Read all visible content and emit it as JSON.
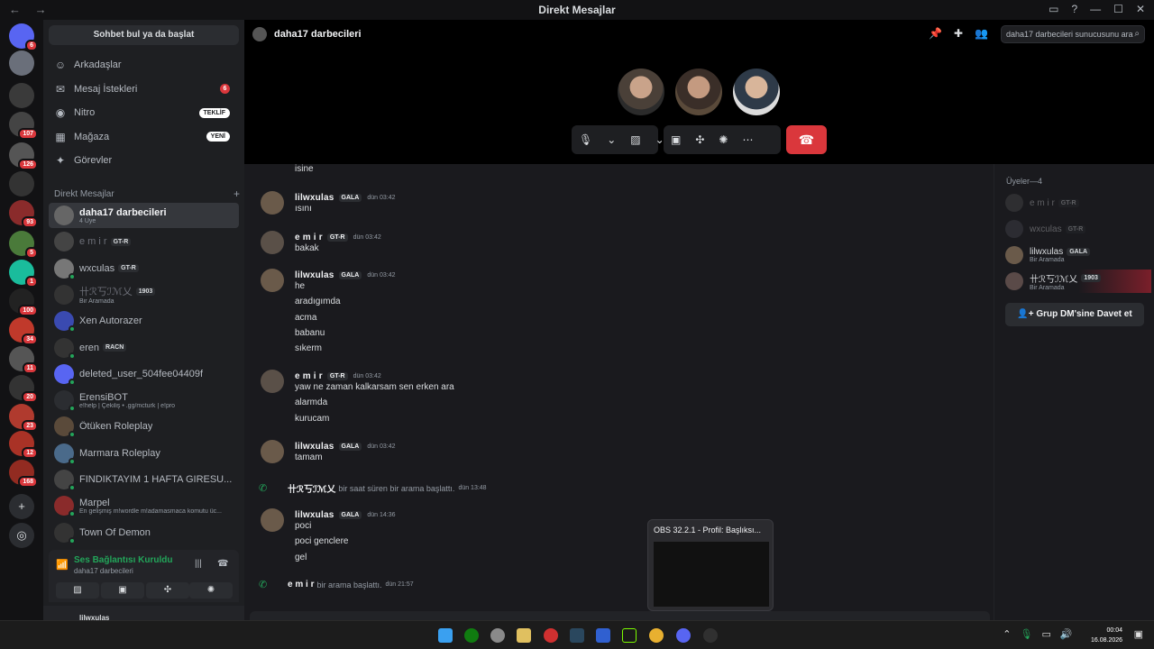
{
  "window": {
    "title": "Direkt Mesajlar"
  },
  "servers": [
    {
      "badge": "6",
      "color": "#5865f2"
    },
    {
      "badge": "",
      "color": "#6a6f7a"
    },
    {
      "badge": "",
      "color": "#3a3a3a"
    },
    {
      "badge": "107",
      "color": "#444"
    },
    {
      "badge": "126",
      "color": "#555"
    },
    {
      "badge": "",
      "color": "#333"
    },
    {
      "badge": "93",
      "color": "#8a2b2b"
    },
    {
      "badge": "5",
      "color": "#4a7a3a"
    },
    {
      "badge": "1",
      "color": "#1abc9c"
    },
    {
      "badge": "100",
      "color": "#222"
    },
    {
      "badge": "34",
      "color": "#c0392b"
    },
    {
      "badge": "11",
      "color": "#555"
    },
    {
      "badge": "20",
      "color": "#333"
    },
    {
      "badge": "23",
      "color": "#b03a2e"
    },
    {
      "badge": "12",
      "color": "#a93226"
    },
    {
      "badge": "168",
      "color": "#922b21"
    }
  ],
  "sidebar": {
    "search_label": "Sohbet bul ya da başlat",
    "nav": [
      {
        "label": "Arkadaşlar",
        "icon": "friends-icon",
        "tag": "",
        "count": ""
      },
      {
        "label": "Mesaj İstekleri",
        "icon": "mail-icon",
        "tag": "",
        "count": "6"
      },
      {
        "label": "Nitro",
        "icon": "nitro-icon",
        "tag": "TEKLİF",
        "count": ""
      },
      {
        "label": "Mağaza",
        "icon": "shop-icon",
        "tag": "YENİ",
        "count": ""
      },
      {
        "label": "Görevler",
        "icon": "quests-icon",
        "tag": "",
        "count": ""
      }
    ],
    "dm_header": "Direkt Mesajlar",
    "dms": [
      {
        "name": "daha17 darbecileri",
        "sub": "4 Üye",
        "chip": "",
        "selected": true
      },
      {
        "name": "e m i r",
        "sub": "",
        "chip": "GT-R",
        "dim": true
      },
      {
        "name": "wxculas",
        "sub": "",
        "chip": "GT-R"
      },
      {
        "name": "卄ℛ丂ℐℳ乂",
        "sub": "Bir Aramada",
        "chip": "1903",
        "dim": true
      },
      {
        "name": "Xen Autorazer",
        "sub": "",
        "chip": ""
      },
      {
        "name": "eren",
        "sub": "",
        "chip": "RACN"
      },
      {
        "name": "deleted_user_504fee04409f",
        "sub": "",
        "chip": ""
      },
      {
        "name": "ErensiBOT",
        "sub": "e!help | Çekiliş • .gg/mcturk | e!pro",
        "chip": ""
      },
      {
        "name": "Ötüken Roleplay",
        "sub": "",
        "chip": ""
      },
      {
        "name": "Marmara Roleplay",
        "sub": "",
        "chip": ""
      },
      {
        "name": "FINDIKTAYIM 1 HAFTA GIRESU...",
        "sub": "",
        "chip": ""
      },
      {
        "name": "Marpel",
        "sub": "En gelişmiş m!wordle m!adamasmaca komutu üc...",
        "chip": ""
      },
      {
        "name": "Town Of Demon",
        "sub": "",
        "chip": ""
      }
    ],
    "voice": {
      "status": "Ses Bağlantısı Kuruldu",
      "channel": "daha17 darbecileri"
    },
    "user": {
      "name": "lilwxulas"
    }
  },
  "channel": {
    "title": "daha17 darbecileri",
    "search_placeholder": "daha17 darbecileri sunucusunu ara"
  },
  "messages": [
    {
      "lines": [
        "isine"
      ],
      "continuation": true
    },
    {
      "user": "lilwxulas",
      "role": "GALA",
      "time": "dün 03:42",
      "lines": [
        "ısını"
      ]
    },
    {
      "user": "e m i r",
      "role": "GT-R",
      "time": "dün 03:42",
      "lines": [
        "bakak"
      ]
    },
    {
      "user": "lilwxulas",
      "role": "GALA",
      "time": "dün 03:42",
      "lines": [
        "he",
        "aradıgımda",
        "acma",
        "babanu",
        "sıkerm"
      ]
    },
    {
      "user": "e m i r",
      "role": "GT-R",
      "time": "dün 03:42",
      "lines": [
        "yaw ne zaman kalkarsam sen erken ara",
        "alarmda",
        "kurucam"
      ]
    },
    {
      "user": "lilwxulas",
      "role": "GALA",
      "time": "dün 03:42",
      "lines": [
        "tamam"
      ]
    },
    {
      "system": true,
      "user": "卄ℛ丂ℐℳ乂",
      "text": "bir saat süren bir arama başlattı.",
      "time": "dün 13:48"
    },
    {
      "user": "lilwxulas",
      "role": "GALA",
      "time": "dün 14:36",
      "lines": [
        "poci",
        "poci genclere",
        "gel"
      ]
    },
    {
      "system": true,
      "user": "e m i r",
      "text": "bir arama başlattı.",
      "time": "dün 21:57"
    }
  ],
  "members": {
    "header": "Üyeler—4",
    "list": [
      {
        "name": "e m i r",
        "role": "GT-R",
        "sub": "",
        "dim": true
      },
      {
        "name": "wxculas",
        "role": "GT-R",
        "sub": "",
        "dim": true
      },
      {
        "name": "lilwxulas",
        "role": "GALA",
        "sub": "Bir Aramada"
      },
      {
        "name": "卄ℛ丂ℐℳ乂",
        "role": "1903",
        "sub": "Bir Aramada"
      }
    ],
    "invite_label": "Grup DM'sine Davet et"
  },
  "obs_preview": {
    "title": "OBS 32.2.1 - Profil: Başlıksı..."
  },
  "clock": {
    "time": "00:04",
    "date": "16.08.2026"
  }
}
